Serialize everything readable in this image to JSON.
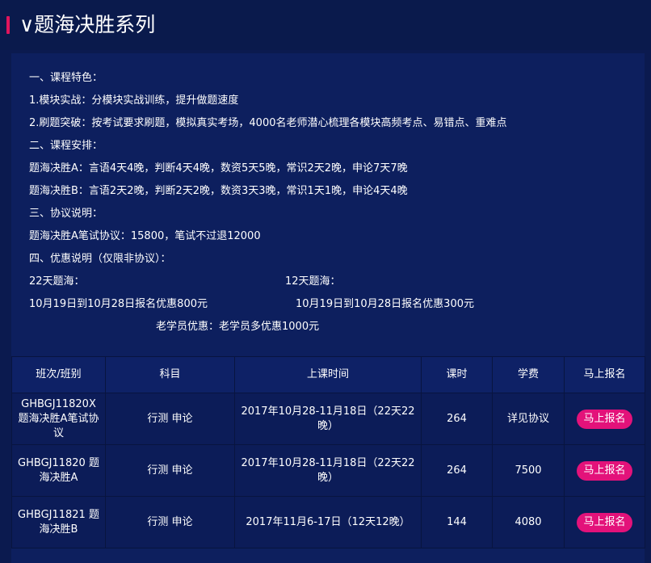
{
  "header": {
    "title": "∨题海决胜系列"
  },
  "info": {
    "features_heading": "一、课程特色：",
    "feature_1": "1.模块实战：分模块实战训练，提升做题速度",
    "feature_2": "2.刷题突破：按考试要求刷题，模拟真实考场，4000名老师潜心梳理各模块高频考点、易错点、重难点",
    "schedule_heading": "二、课程安排：",
    "schedule_a": "题海决胜A：言语4天4晚，判断4天4晚，数资5天5晚，常识2天2晚，申论7天7晚",
    "schedule_b": "题海决胜B：言语2天2晚，判断2天2晚，数资3天3晚，常识1天1晚，申论4天4晚",
    "agreement_heading": "三、协议说明：",
    "agreement_a": "题海决胜A笔试协议：15800，笔试不过退12000",
    "discount_heading": "四、优惠说明（仅限非协议）：",
    "discount_22_label": "22天题海：",
    "discount_12_label": "12天题海：",
    "discount_22_detail": "10月19日到10月28日报名优惠800元",
    "discount_12_detail": "10月19日到10月28日报名优惠300元",
    "discount_old": "老学员优惠：老学员多优惠1000元"
  },
  "table": {
    "headers": [
      "班次/班别",
      "科目",
      "上课时间",
      "课时",
      "学费",
      "马上报名"
    ],
    "rows": [
      {
        "class": "GHBGJ11820X 题海决胜A笔试协议",
        "subject": "行测 申论",
        "time": "2017年10月28-11月18日（22天22晚）",
        "hours": "264",
        "fee": "详见协议",
        "button": "马上报名"
      },
      {
        "class": "GHBGJ11820 题海决胜A",
        "subject": "行测 申论",
        "time": "2017年10月28-11月18日（22天22晚）",
        "hours": "264",
        "fee": "7500",
        "button": "马上报名"
      },
      {
        "class": "GHBGJ11821 题海决胜B",
        "subject": "行测 申论",
        "time": "2017年11月6-17日（12天12晚）",
        "hours": "144",
        "fee": "4080",
        "button": "马上报名"
      }
    ]
  },
  "colors": {
    "background": "#0b1a4f",
    "accent_bar": "#e0145c",
    "button": "#e3127a"
  }
}
